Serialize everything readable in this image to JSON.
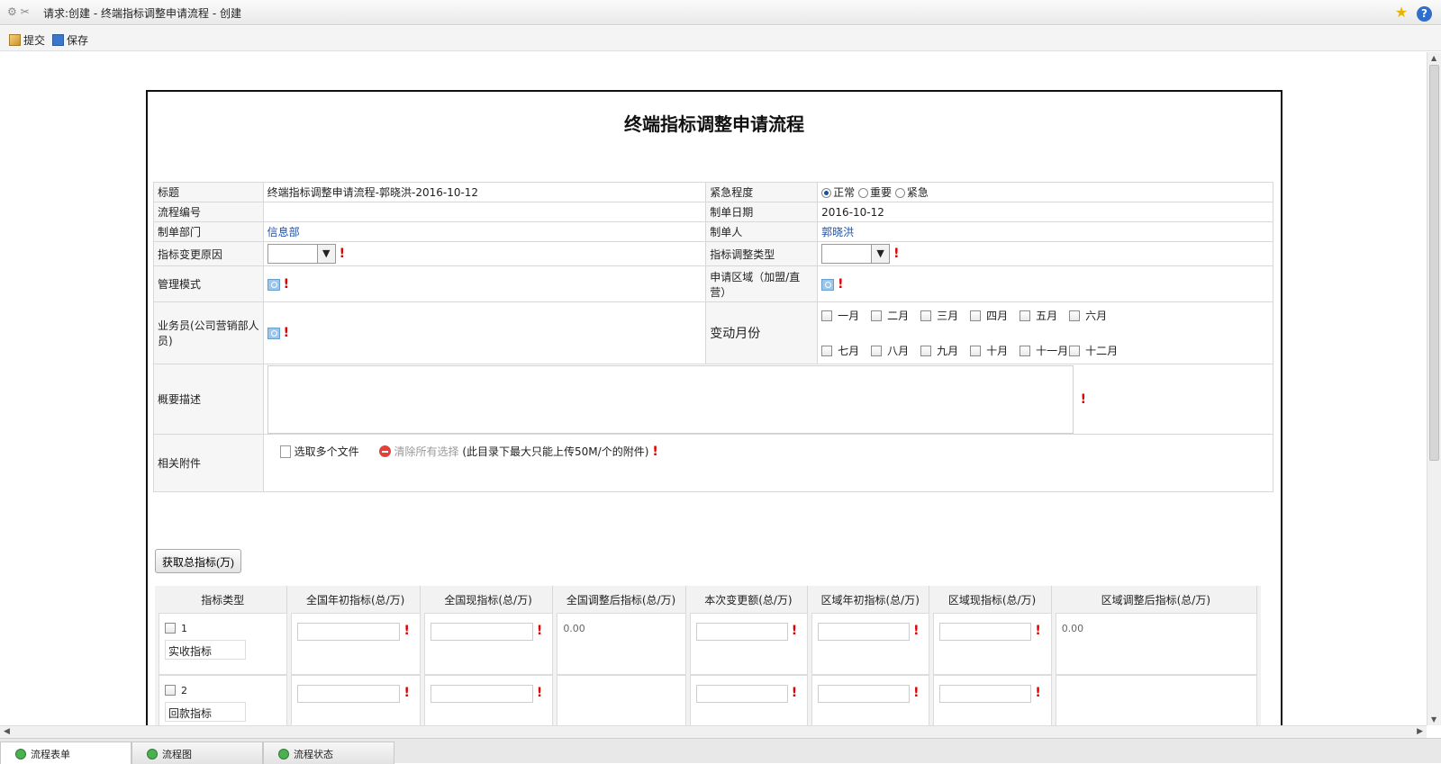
{
  "window": {
    "title": "请求:创建 - 终端指标调整申请流程 - 创建"
  },
  "toolbar": {
    "submit_label": "提交",
    "save_label": "保存"
  },
  "form": {
    "heading": "终端指标调整申请流程",
    "fields": {
      "title_label": "标题",
      "title_value": "终端指标调整申请流程-郭晓洪-2016-10-12",
      "urgency_label": "紧急程度",
      "urgency_options": [
        "正常",
        "重要",
        "紧急"
      ],
      "urgency_selected": "正常",
      "flow_no_label": "流程编号",
      "flow_no_value": "",
      "date_label": "制单日期",
      "date_value": "2016-10-12",
      "dept_label": "制单部门",
      "dept_value": "信息部",
      "creator_label": "制单人",
      "creator_value": "郭晓洪",
      "reason_label": "指标变更原因",
      "adjust_type_label": "指标调整类型",
      "mgmt_mode_label": "管理模式",
      "region_label": "申请区域（加盟/直营）",
      "salesman_label": "业务员(公司营销部人员)",
      "months_label": "变动月份",
      "months": [
        "一月",
        "二月",
        "三月",
        "四月",
        "五月",
        "六月",
        "七月",
        "八月",
        "九月",
        "十月",
        "十一月",
        "十二月"
      ],
      "summary_label": "概要描述",
      "attach_label": "相关附件",
      "select_files": "选取多个文件",
      "clear_selection": "清除所有选择",
      "upload_note": "(此目录下最大只能上传50M/个的附件)"
    },
    "get_total_button": "获取总指标(万)",
    "grid": {
      "headers": [
        "指标类型",
        "全国年初指标(总/万)",
        "全国现指标(总/万)",
        "全国调整后指标(总/万)",
        "本次变更额(总/万)",
        "区域年初指标(总/万)",
        "区域现指标(总/万)",
        "区域调整后指标(总/万)"
      ],
      "rows": [
        {
          "no": "1",
          "name": "实收指标",
          "national_adjusted": "0.00",
          "region_adjusted": "0.00"
        },
        {
          "no": "2",
          "name": "回款指标",
          "national_adjusted": "",
          "region_adjusted": ""
        }
      ]
    }
  },
  "bottom_tabs": [
    "流程表单",
    "流程图",
    "流程状态"
  ]
}
